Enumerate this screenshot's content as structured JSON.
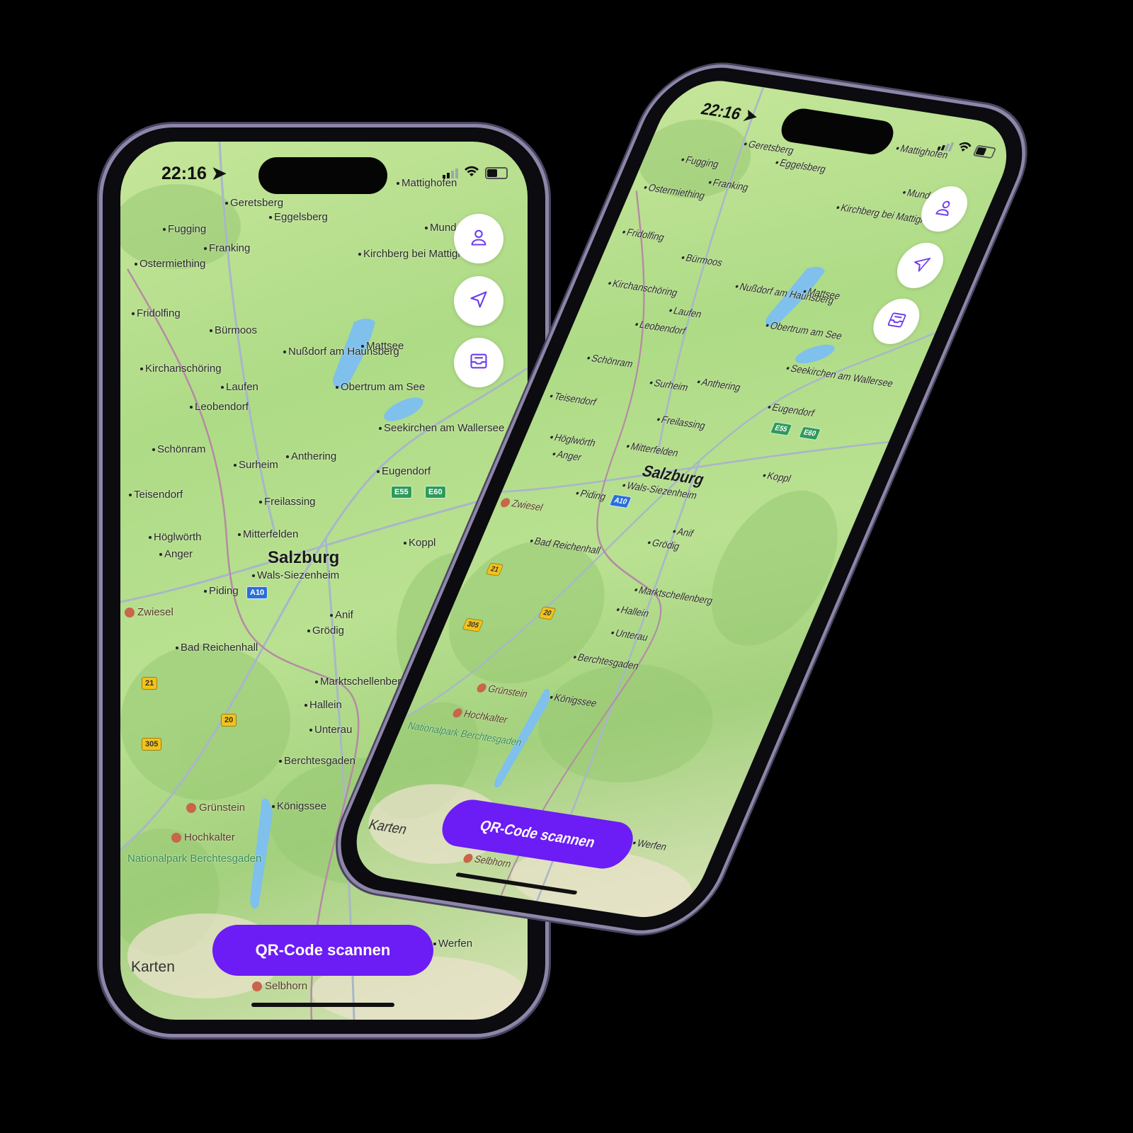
{
  "status": {
    "time": "22:16"
  },
  "map": {
    "labels": [
      {
        "text": "Mattighofen",
        "kind": "town"
      },
      {
        "text": "Geretsberg",
        "kind": "town"
      },
      {
        "text": "Eggelsberg",
        "kind": "town"
      },
      {
        "text": "Fugging",
        "kind": "town"
      },
      {
        "text": "Franking",
        "kind": "town"
      },
      {
        "text": "Ostermiething",
        "kind": "town"
      },
      {
        "text": "Munderfing",
        "kind": "town"
      },
      {
        "text": "Kirchberg bei Mattighofen",
        "kind": "town"
      },
      {
        "text": "Fridolfing",
        "kind": "town"
      },
      {
        "text": "Bürmoos",
        "kind": "town"
      },
      {
        "text": "Nußdorf am Haunsberg",
        "kind": "town"
      },
      {
        "text": "Mattsee",
        "kind": "town"
      },
      {
        "text": "Kirchanschöring",
        "kind": "town"
      },
      {
        "text": "Laufen",
        "kind": "town"
      },
      {
        "text": "Obertrum am See",
        "kind": "town"
      },
      {
        "text": "Leobendorf",
        "kind": "town"
      },
      {
        "text": "Seekirchen am Wallersee",
        "kind": "town"
      },
      {
        "text": "Schönram",
        "kind": "town"
      },
      {
        "text": "Surheim",
        "kind": "town"
      },
      {
        "text": "Anthering",
        "kind": "town"
      },
      {
        "text": "Eugendorf",
        "kind": "town"
      },
      {
        "text": "Teisendorf",
        "kind": "town"
      },
      {
        "text": "Freilassing",
        "kind": "town"
      },
      {
        "text": "Höglwörth",
        "kind": "town"
      },
      {
        "text": "Mitterfelden",
        "kind": "town"
      },
      {
        "text": "Salzburg",
        "kind": "city"
      },
      {
        "text": "Koppl",
        "kind": "town"
      },
      {
        "text": "Anger",
        "kind": "town"
      },
      {
        "text": "Wals-Siezenheim",
        "kind": "town"
      },
      {
        "text": "Piding",
        "kind": "town"
      },
      {
        "text": "Zwiesel",
        "kind": "poi"
      },
      {
        "text": "Anif",
        "kind": "town"
      },
      {
        "text": "Grödig",
        "kind": "town"
      },
      {
        "text": "Bad Reichenhall",
        "kind": "town"
      },
      {
        "text": "Marktschellenberg",
        "kind": "town"
      },
      {
        "text": "Hallein",
        "kind": "town"
      },
      {
        "text": "Unterau",
        "kind": "town"
      },
      {
        "text": "Berchtesgaden",
        "kind": "town"
      },
      {
        "text": "Grünstein",
        "kind": "poi"
      },
      {
        "text": "Königssee",
        "kind": "town"
      },
      {
        "text": "Hochkalter",
        "kind": "poi"
      },
      {
        "text": "Nationalpark Berchtesgaden",
        "kind": "park"
      },
      {
        "text": "Selbhorn",
        "kind": "poi"
      },
      {
        "text": "Werfen",
        "kind": "town"
      }
    ],
    "shields": [
      {
        "text": "E55",
        "type": "e"
      },
      {
        "text": "E60",
        "type": "e"
      },
      {
        "text": "A10",
        "type": "a"
      },
      {
        "text": "21",
        "type": "b"
      },
      {
        "text": "20",
        "type": "b"
      },
      {
        "text": "305",
        "type": "b"
      }
    ],
    "attribution": "Karten"
  },
  "buttons": [
    {
      "name": "profile",
      "icon": "person-icon"
    },
    {
      "name": "locate",
      "icon": "location-arrow-icon"
    },
    {
      "name": "inbox",
      "icon": "inbox-icon"
    }
  ],
  "qr_button": {
    "label": "QR-Code scannen"
  },
  "colors": {
    "accent": "#6c1cf5",
    "icon": "#6c3cf0"
  }
}
